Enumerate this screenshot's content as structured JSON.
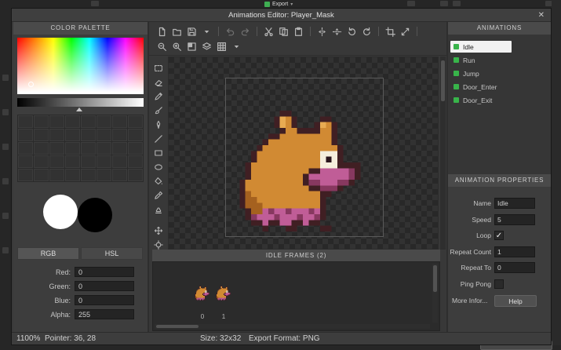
{
  "window": {
    "title": "Animations Editor: Player_Mask",
    "close_glyph": "✕"
  },
  "background": {
    "export_label": "Export",
    "caret_glyph": "▾"
  },
  "palette": {
    "header": "COLOR PALETTE",
    "rgb_label": "RGB",
    "hsl_label": "HSL",
    "grid": {
      "cols": 8,
      "rows": 5
    },
    "primary_color": "#ffffff",
    "secondary_color": "#000000",
    "fields": [
      {
        "label": "Red:",
        "value": "0"
      },
      {
        "label": "Green:",
        "value": "0"
      },
      {
        "label": "Blue:",
        "value": "0"
      },
      {
        "label": "Alpha:",
        "value": "255"
      }
    ]
  },
  "toolbar": {
    "row1": [
      "new-file",
      "open-folder",
      "save",
      "caret-down",
      "|",
      "undo",
      "redo",
      "|",
      "cut",
      "copy",
      "paste",
      "|",
      "flip-h",
      "flip-v",
      "rotate-ccw",
      "rotate-cw",
      "|",
      "crop",
      "resize",
      "|",
      "zoom"
    ],
    "row2": [
      "zoom-out",
      "zoom-in",
      "color-select",
      "layers",
      "grid",
      "caret-down"
    ],
    "tools": [
      "select-rect",
      "eraser",
      "pencil",
      "brush",
      "pen",
      "line",
      "rect-tool",
      "ellipse-tool",
      "fill",
      "eyedropper",
      "stamp",
      "-",
      "move",
      "target"
    ]
  },
  "animations": {
    "header": "ANIMATIONS",
    "icon_color": "#38b44a",
    "items": [
      {
        "label": "Idle",
        "selected": true
      },
      {
        "label": "Run",
        "selected": false
      },
      {
        "label": "Jump",
        "selected": false
      },
      {
        "label": "Door_Enter",
        "selected": false
      },
      {
        "label": "Door_Exit",
        "selected": false
      }
    ]
  },
  "properties": {
    "header": "ANIMATION PROPERTIES",
    "name_label": "Name",
    "name_value": "Idle",
    "speed_label": "Speed",
    "speed_value": "5",
    "loop_label": "Loop",
    "loop_checked": true,
    "repeat_count_label": "Repeat Count",
    "repeat_count_value": "1",
    "repeat_to_label": "Repeat To",
    "repeat_to_value": "0",
    "ping_pong_label": "Ping Pong",
    "ping_pong_checked": false,
    "more_info_label": "More Infor...",
    "help_label": "Help",
    "check_glyph": "✓"
  },
  "frames": {
    "header": "IDLE FRAMES (2)",
    "indices": [
      "0",
      "1"
    ]
  },
  "status": {
    "zoom": "1100%",
    "pointer": "Pointer: 36, 28",
    "size": "Size: 32x32",
    "export_format": "Export Format: PNG"
  },
  "sprite": {
    "palette": {
      "O": "#401f23",
      "o": "#d18a33",
      "l": "#e9ab52",
      "d": "#a5611f",
      "w": "#f5eedd",
      "k": "#2a161d",
      "p": "#c05d97",
      "P": "#87385f"
    },
    "pixels": [
      "........OO..............",
      ".......OloO....OO.......",
      ".......OloO...OloO......",
      "........OooOOOOooO......",
      "......OOoooooooooO......",
      ".....OoooooooooooO......",
      "....OoooooooooooooO.....",
      "...OooooooooooowwwO.....",
      "...OooooooooooowkwO.....",
      "..OoooooooooooowwwOOOO..",
      "..OooooooooooOOpppppPO..",
      "..OoooooooooOpppppppPO..",
      ".OooooooooooOPPpppPPO...",
      ".OoooooooooooOOPPPO.....",
      ".OdooooooooooooOO.......",
      ".OddoooooooooooO........",
      ".OdddooooooooooO........",
      "..OddpPppPpppPpO........",
      "..OPpppPpppPppPO........",
      "...OOpOOppOOpOO.........",
      ".....O...OO....OO......."
    ]
  }
}
